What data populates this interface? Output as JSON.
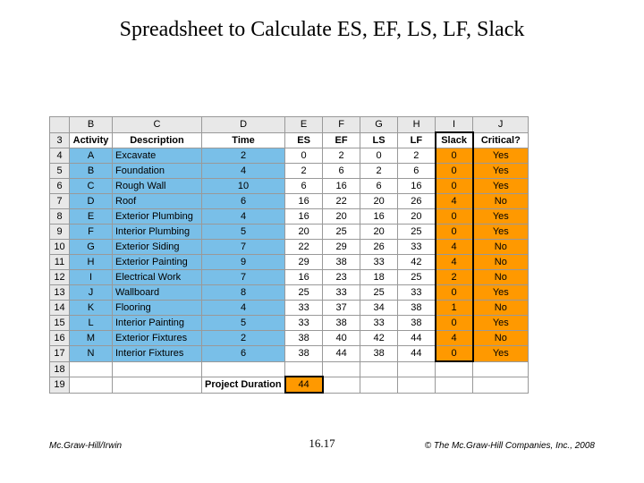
{
  "title": "Spreadsheet to Calculate ES, EF, LS, LF, Slack",
  "footer": {
    "left": "Mc.Graw-Hill/Irwin",
    "center": "16.17",
    "right": "© The Mc.Graw-Hill Companies, Inc., 2008"
  },
  "cols": [
    "B",
    "C",
    "D",
    "E",
    "F",
    "G",
    "H",
    "I",
    "J"
  ],
  "row3": {
    "B": "Activity",
    "C": "Description",
    "D": "Time",
    "E": "ES",
    "F": "EF",
    "G": "LS",
    "H": "LF",
    "I": "Slack",
    "J": "Critical?"
  },
  "dataRowNumbers": [
    "4",
    "5",
    "6",
    "7",
    "8",
    "9",
    "10",
    "11",
    "12",
    "13",
    "14",
    "15",
    "16",
    "17"
  ],
  "rows": [
    {
      "B": "A",
      "C": "Excavate",
      "D": "2",
      "E": "0",
      "F": "2",
      "G": "0",
      "H": "2",
      "I": "0",
      "J": "Yes"
    },
    {
      "B": "B",
      "C": "Foundation",
      "D": "4",
      "E": "2",
      "F": "6",
      "G": "2",
      "H": "6",
      "I": "0",
      "J": "Yes"
    },
    {
      "B": "C",
      "C": "Rough Wall",
      "D": "10",
      "E": "6",
      "F": "16",
      "G": "6",
      "H": "16",
      "I": "0",
      "J": "Yes"
    },
    {
      "B": "D",
      "C": "Roof",
      "D": "6",
      "E": "16",
      "F": "22",
      "G": "20",
      "H": "26",
      "I": "4",
      "J": "No"
    },
    {
      "B": "E",
      "C": "Exterior Plumbing",
      "D": "4",
      "E": "16",
      "F": "20",
      "G": "16",
      "H": "20",
      "I": "0",
      "J": "Yes"
    },
    {
      "B": "F",
      "C": "Interior Plumbing",
      "D": "5",
      "E": "20",
      "F": "25",
      "G": "20",
      "H": "25",
      "I": "0",
      "J": "Yes"
    },
    {
      "B": "G",
      "C": "Exterior Siding",
      "D": "7",
      "E": "22",
      "F": "29",
      "G": "26",
      "H": "33",
      "I": "4",
      "J": "No"
    },
    {
      "B": "H",
      "C": "Exterior Painting",
      "D": "9",
      "E": "29",
      "F": "38",
      "G": "33",
      "H": "42",
      "I": "4",
      "J": "No"
    },
    {
      "B": "I",
      "C": "Electrical Work",
      "D": "7",
      "E": "16",
      "F": "23",
      "G": "18",
      "H": "25",
      "I": "2",
      "J": "No"
    },
    {
      "B": "J",
      "C": "Wallboard",
      "D": "8",
      "E": "25",
      "F": "33",
      "G": "25",
      "H": "33",
      "I": "0",
      "J": "Yes"
    },
    {
      "B": "K",
      "C": "Flooring",
      "D": "4",
      "E": "33",
      "F": "37",
      "G": "34",
      "H": "38",
      "I": "1",
      "J": "No"
    },
    {
      "B": "L",
      "C": "Interior Painting",
      "D": "5",
      "E": "33",
      "F": "38",
      "G": "33",
      "H": "38",
      "I": "0",
      "J": "Yes"
    },
    {
      "B": "M",
      "C": "Exterior Fixtures",
      "D": "2",
      "E": "38",
      "F": "40",
      "G": "42",
      "H": "44",
      "I": "4",
      "J": "No"
    },
    {
      "B": "N",
      "C": "Interior Fixtures",
      "D": "6",
      "E": "38",
      "F": "44",
      "G": "38",
      "H": "44",
      "I": "0",
      "J": "Yes"
    }
  ],
  "emptyRow": "18",
  "durRow": {
    "num": "19",
    "label": "Project Duration",
    "value": "44"
  }
}
